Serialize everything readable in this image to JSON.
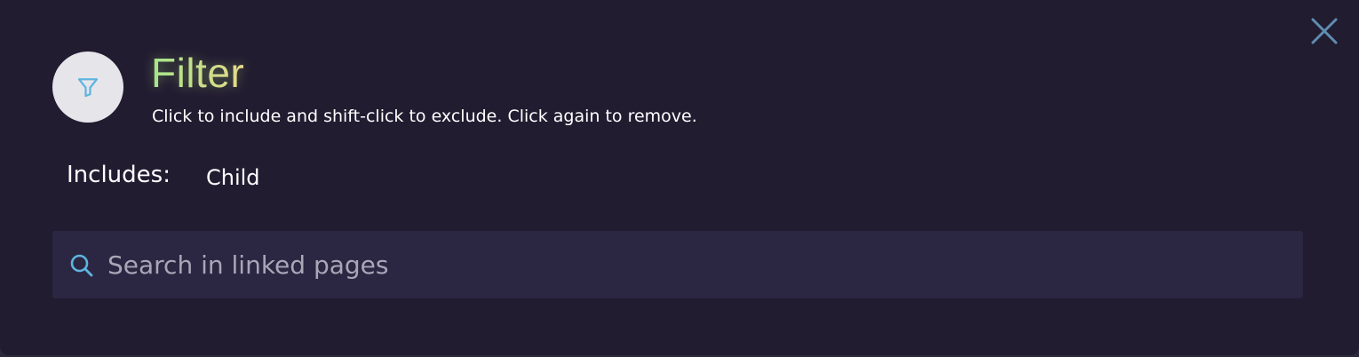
{
  "dialog": {
    "title": "Filter",
    "subtitle": "Click to include and shift-click to exclude. Click again to remove.",
    "includes_label": "Includes:",
    "includes_items": [
      "Child"
    ],
    "search": {
      "placeholder": "Search in linked pages",
      "value": ""
    }
  },
  "icons": {
    "badge": "filter-icon",
    "close": "close-icon",
    "search": "search-icon"
  },
  "colors": {
    "background": "#221c31",
    "accent": "#5aa8d6",
    "title_gradient_start": "#a6e58a",
    "title_gradient_end": "#e7d98a",
    "search_bg": "#2b2742"
  }
}
